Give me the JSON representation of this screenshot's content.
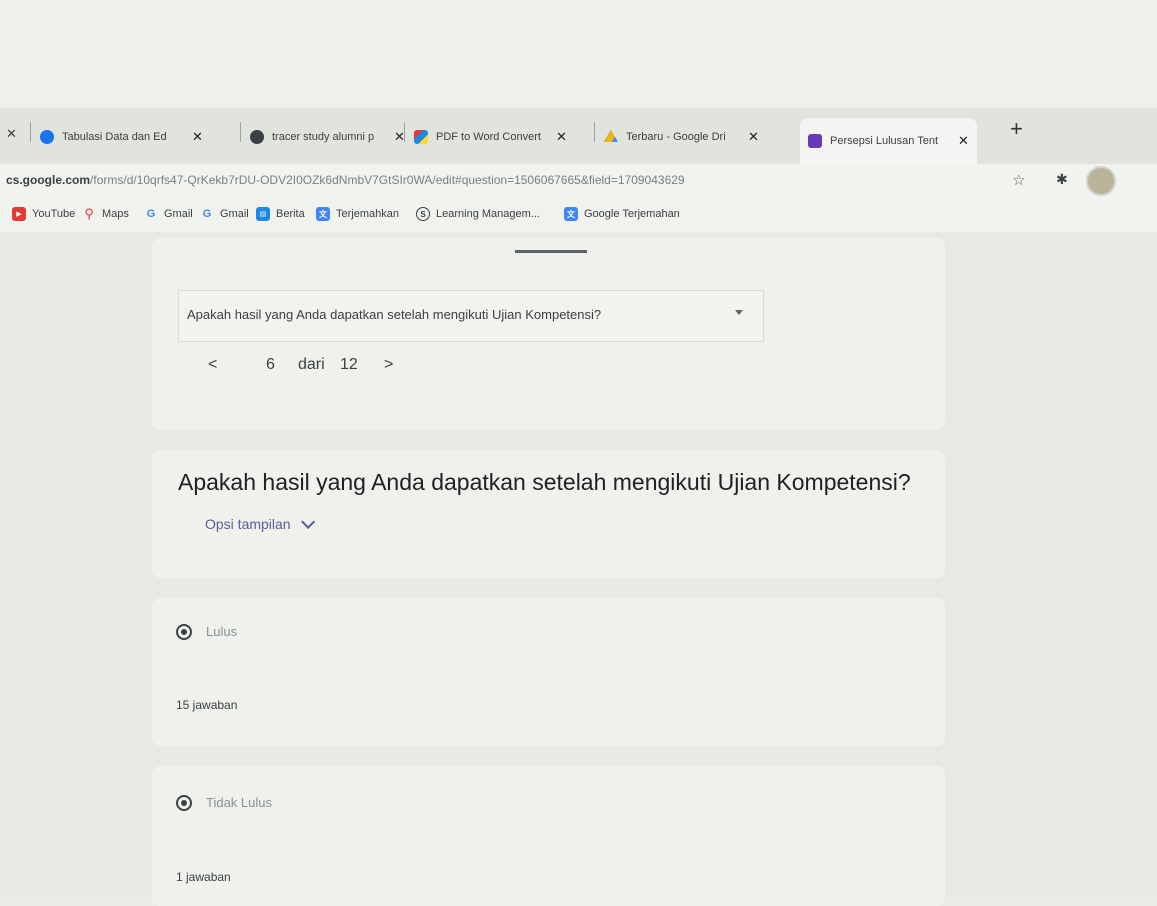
{
  "tabs": [
    {
      "title": "Tabulasi Data dan Ed",
      "icon": "google-forms-blue-icon"
    },
    {
      "title": "tracer study alumni p",
      "icon": "globe-icon"
    },
    {
      "title": "PDF to Word Convert",
      "icon": "pdf-converter-icon"
    },
    {
      "title": "Terbaru - Google Dri",
      "icon": "google-drive-icon"
    },
    {
      "title": "Persepsi Lulusan Tent",
      "icon": "google-forms-icon"
    }
  ],
  "address_bar": {
    "url_host": "cs.google.com",
    "url_path": "/forms/d/10qrfs47-QrKekb7rDU-ODV2I0OZk6dNmbV7GtSIr0WA/edit#question=1506067665&field=1709043629"
  },
  "bookmarks": [
    "YouTube",
    "Maps",
    "Gmail",
    "Gmail",
    "Berita",
    "Terjemahkan",
    "Learning Managem...",
    "Google Terjemahan"
  ],
  "question_selector": {
    "selected": "Apakah hasil yang Anda dapatkan setelah mengikuti Ujian Kompetensi?",
    "page_current": "6",
    "page_of": "dari",
    "page_total": "12"
  },
  "question": {
    "title": "Apakah hasil yang Anda dapatkan setelah mengikuti Ujian Kompetensi?",
    "display_options": "Opsi tampilan"
  },
  "answers": [
    {
      "label": "Lulus",
      "count": "15 jawaban"
    },
    {
      "label": "Tidak Lulus",
      "count": "1 jawaban"
    }
  ],
  "colors": {
    "accent": "#5f5a9e",
    "forms": "#673ab7"
  }
}
